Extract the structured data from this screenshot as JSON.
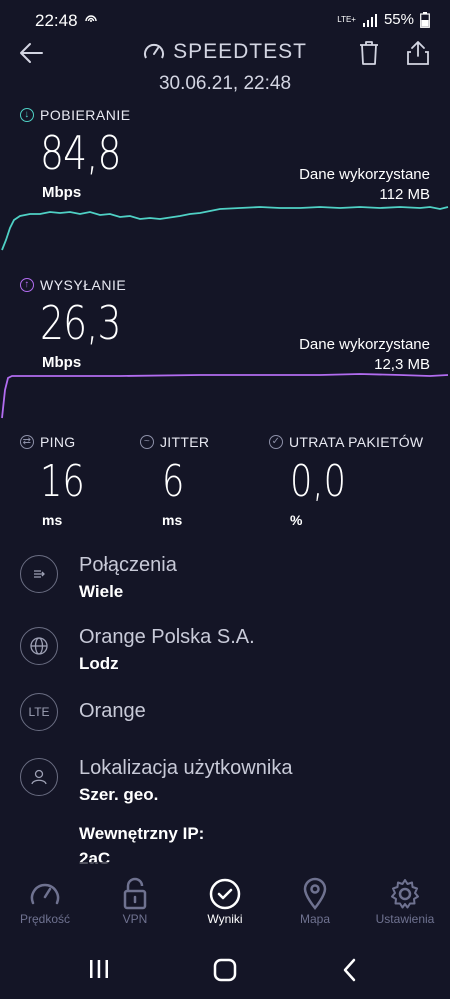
{
  "status": {
    "time": "22:48",
    "net_small": "LTE+",
    "battery": "55%"
  },
  "header": {
    "title": "SPEEDTEST",
    "datetime": "30.06.21, 22:48"
  },
  "download": {
    "label": "POBIERANIE",
    "value": "84,8",
    "unit": "Mbps",
    "data_used_label": "Dane wykorzystane",
    "data_used_value": "112 MB",
    "color": "#4fd1c5"
  },
  "upload": {
    "label": "WYSYŁANIE",
    "value": "26,3",
    "unit": "Mbps",
    "data_used_label": "Dane wykorzystane",
    "data_used_value": "12,3 MB",
    "color": "#b26cf0"
  },
  "metrics": {
    "ping": {
      "label": "PING",
      "value": "16",
      "unit": "ms"
    },
    "jitter": {
      "label": "JITTER",
      "value": "6",
      "unit": "ms"
    },
    "loss": {
      "label": "UTRATA PAKIETÓW",
      "value": "0,0",
      "unit": "%"
    }
  },
  "info": {
    "connections": {
      "title": "Połączenia",
      "sub": "Wiele",
      "icon": "connections-icon"
    },
    "provider": {
      "title": "Orange Polska S.A.",
      "sub": "Lodz",
      "icon": "globe-icon"
    },
    "network": {
      "title": "Orange",
      "icon_text": "LTE"
    },
    "location": {
      "title": "Lokalizacja użytkownika",
      "sub": "Szer. geo.",
      "icon": "user-icon"
    },
    "internal_ip": {
      "label": "Wewnętrzny IP:",
      "value": "2aC"
    }
  },
  "bottom_nav": [
    {
      "label": "Prędkość",
      "icon": "speedometer-icon"
    },
    {
      "label": "VPN",
      "icon": "lock-icon"
    },
    {
      "label": "Wyniki",
      "icon": "check-circle-icon"
    },
    {
      "label": "Mapa",
      "icon": "map-pin-icon"
    },
    {
      "label": "Ustawienia",
      "icon": "gear-icon"
    }
  ]
}
